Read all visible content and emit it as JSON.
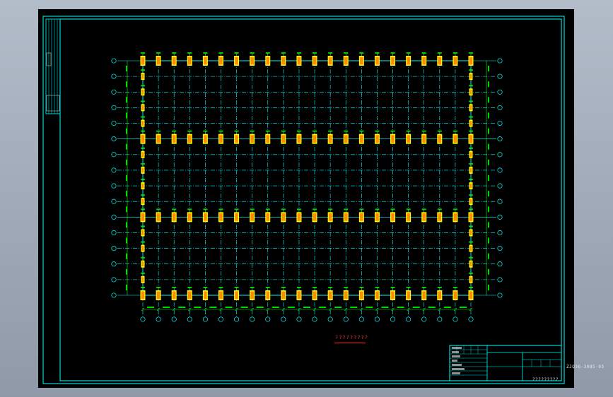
{
  "drawing": {
    "plan_title": "?????????",
    "title_block": {
      "drawing_number": "ZJQ36-3085-03",
      "drawing_name": "?????????"
    },
    "grid": {
      "column_lines": 22,
      "row_lines": 16,
      "full_frame_rows": [
        1,
        6,
        11,
        16
      ]
    },
    "colors": {
      "frame": "#00ffff",
      "grid_line": "#00ffff",
      "column_outer": "#ffff00",
      "column_inner": "#ff8c00",
      "dimension": "#00ff00",
      "bubble": "#00ffff",
      "title_text": "#ff3030"
    }
  }
}
